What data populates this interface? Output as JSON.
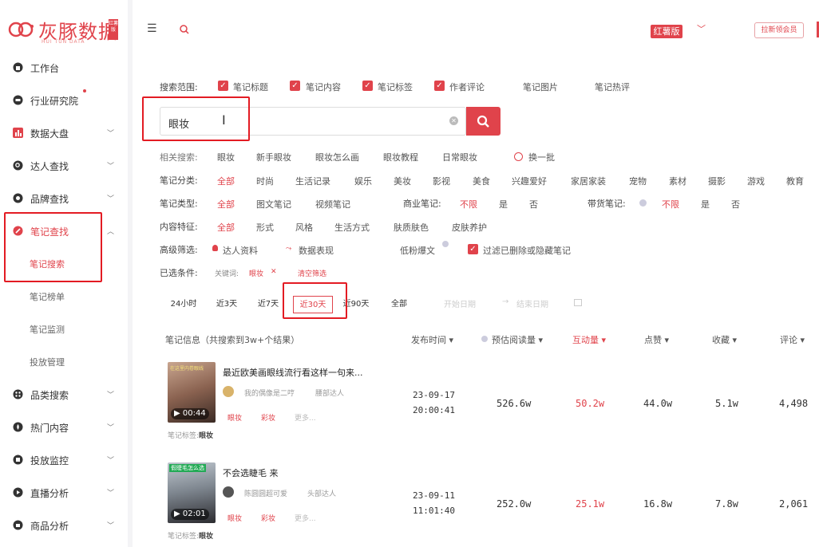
{
  "brand": {
    "name": "灰豚数据",
    "sub": "HUI TUN DATA",
    "tag": "红薯版"
  },
  "nav": [
    {
      "label": "工作台",
      "icon": "home-icon",
      "chevron": ""
    },
    {
      "label": "行业研究院",
      "icon": "industry-icon",
      "chevron": ""
    },
    {
      "label": "数据大盘",
      "icon": "chart-icon",
      "chevron": "﹀"
    },
    {
      "label": "达人查找",
      "icon": "search-user-icon",
      "chevron": "﹀"
    },
    {
      "label": "品牌查找",
      "icon": "brand-icon",
      "chevron": "﹀"
    },
    {
      "label": "笔记查找",
      "icon": "note-icon",
      "chevron": "︿"
    }
  ],
  "subnav": [
    {
      "label": "笔记搜索"
    },
    {
      "label": "笔记榜单"
    },
    {
      "label": "笔记监测"
    },
    {
      "label": "投放管理"
    }
  ],
  "nav2": [
    {
      "label": "品类搜索",
      "icon": "category-icon",
      "chevron": "﹀"
    },
    {
      "label": "热门内容",
      "icon": "hot-icon",
      "chevron": "﹀"
    },
    {
      "label": "投放监控",
      "icon": "monitor-icon",
      "chevron": "﹀"
    },
    {
      "label": "直播分析",
      "icon": "live-icon",
      "chevron": "﹀"
    },
    {
      "label": "商品分析",
      "icon": "goods-icon",
      "chevron": "﹀"
    }
  ],
  "header": {
    "version_badge": "红薯版",
    "invite": "拉新领会员",
    "chevron": "﹀",
    "menu_glyph": "☰"
  },
  "scope": {
    "label": "搜索范围:",
    "checked": [
      "笔记标题",
      "笔记内容",
      "笔记标签",
      "作者评论"
    ],
    "unchecked": [
      "笔记图片",
      "笔记热评"
    ]
  },
  "search": {
    "value": "眼妆",
    "clear": "✕",
    "cursor": "I"
  },
  "related": {
    "label": "相关搜索:",
    "items": [
      "眼妆",
      "新手眼妆",
      "眼妆怎么画",
      "眼妆教程",
      "日常眼妆"
    ],
    "refresh": "换一批"
  },
  "category": {
    "label": "笔记分类:",
    "items": [
      "全部",
      "时尚",
      "生活记录",
      "娱乐",
      "美妆",
      "影视",
      "美食",
      "兴趣爱好",
      "家居家装",
      "宠物",
      "素材",
      "摄影",
      "游戏",
      "教育"
    ]
  },
  "note_type": {
    "label": "笔记类型:",
    "items": [
      "全部",
      "图文笔记",
      "视频笔记"
    ],
    "commercial_label": "商业笔记:",
    "commercial": [
      "不限",
      "是",
      "否"
    ],
    "goods_label": "带货笔记:",
    "goods": [
      "不限",
      "是",
      "否"
    ]
  },
  "content_feature": {
    "label": "内容特征:",
    "items": [
      "全部",
      "形式",
      "风格",
      "生活方式",
      "肤质肤色",
      "皮肤养护"
    ]
  },
  "advanced": {
    "label": "高级筛选:",
    "talent": "达人资料",
    "data": "数据表现",
    "low_fans": "低粉爆文",
    "filter_deleted": "过滤已删除或隐藏笔记"
  },
  "selected": {
    "label": "已选条件:",
    "keyword_label": "关键词:",
    "keyword": "眼妆",
    "remove": "✕",
    "clear": "清空筛选"
  },
  "date_filters": {
    "items": [
      "24小时",
      "近3天",
      "近7天",
      "近30天",
      "近90天",
      "全部"
    ],
    "selected": "近30天",
    "start": "开始日期",
    "arrow": "→",
    "end": "结束日期"
  },
  "table": {
    "headers": {
      "info": "笔记信息（共搜索到3w+个结果）",
      "time": "发布时间",
      "reads": "预估阅读量",
      "interact": "互动量",
      "likes": "点赞",
      "collect": "收藏",
      "comments": "评论"
    },
    "sort_glyph": "▾",
    "rows": [
      {
        "title": "最近欧美画眼线流行看这样一句来...",
        "thumb_caption": "在这里内卷眼线",
        "duration": "00:44",
        "author": "我的偶像是二哼",
        "author_level": "腰部达人",
        "tags": [
          "眼妆",
          "彩妆",
          "更多..."
        ],
        "note_tag_label": "笔记标签:",
        "note_tag": "眼妆",
        "date": "23-09-17",
        "time": "20:00:41",
        "reads": "526.6w",
        "interact": "50.2w",
        "likes": "44.0w",
        "collect": "5.1w",
        "comments": "4,498"
      },
      {
        "title": "不会选睫毛 来",
        "thumb_caption": "假睫毛怎么选",
        "duration": "02:01",
        "author": "陈圆圆超可爱",
        "author_level": "头部达人",
        "tags": [
          "眼妆",
          "彩妆",
          "更多..."
        ],
        "note_tag_label": "笔记标签:",
        "note_tag": "眼妆",
        "date": "23-09-11",
        "time": "11:01:40",
        "reads": "252.0w",
        "interact": "25.1w",
        "likes": "16.8w",
        "collect": "7.8w",
        "comments": "2,061"
      }
    ]
  },
  "colors": {
    "accent": "#e0434b",
    "highlight_box": "#e31b23"
  }
}
